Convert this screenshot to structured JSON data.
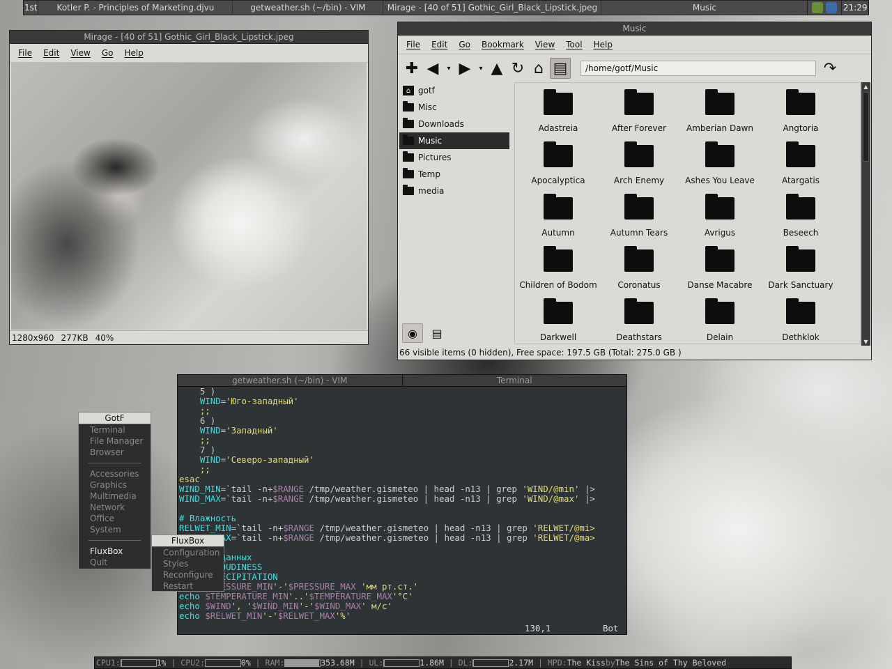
{
  "topbar": {
    "workspace": "1st",
    "tasks": [
      "Kotler P. - Principles of Marketing.djvu",
      "getweather.sh (~/bin) - VIM",
      "Mirage - [40 of 51] Gothic_Girl_Black_Lipstick.jpeg",
      "Music"
    ],
    "clock": "21:29"
  },
  "mirage": {
    "title": "Mirage - [40 of 51] Gothic_Girl_Black_Lipstick.jpeg",
    "menu": [
      "File",
      "Edit",
      "View",
      "Go",
      "Help"
    ],
    "status": [
      "1280x960",
      "277KB",
      "40%"
    ]
  },
  "fm": {
    "title": "Music",
    "menu": [
      "File",
      "Edit",
      "Go",
      "Bookmark",
      "View",
      "Tool",
      "Help"
    ],
    "path": "/home/gotf/Music",
    "sidebar": [
      "gotf",
      "Misc",
      "Downloads",
      "Music",
      "Pictures",
      "Temp",
      "media"
    ],
    "folders": [
      "Adastreia",
      "After Forever",
      "Amberian Dawn",
      "Angtoria",
      "Apocalyptica",
      "Arch Enemy",
      "Ashes You Leave",
      "Atargatis",
      "Autumn",
      "Autumn Tears",
      "Avrigus",
      "Beseech",
      "Children of Bodom",
      "Coronatus",
      "Danse Macabre",
      "Dark Sanctuary",
      "Darkwell",
      "Deathstars",
      "Delain",
      "Dethklok"
    ],
    "status": "66 visible items (0 hidden), Free space: 197.5 GB (Total: 275.0 GB )"
  },
  "terminal": {
    "tabs": [
      "getweather.sh (~/bin) - VIM",
      "Terminal"
    ],
    "position": "130,1",
    "scroll": "Bot"
  },
  "rootmenu": {
    "title": "GotF",
    "group1": [
      "Terminal",
      "File Manager",
      "Browser"
    ],
    "group2": [
      "Accessories",
      "Graphics",
      "Multimedia",
      "Network",
      "Office",
      "System"
    ],
    "group3": [
      "FluxBox",
      "Quit"
    ]
  },
  "fluxmenu": {
    "title": "FluxBox",
    "items": [
      "Configuration",
      "Styles",
      "Reconfigure",
      "Restart"
    ]
  },
  "bottombar": {
    "cpu1_label": "CPU1:",
    "cpu1_value": "1%",
    "cpu1_fill": 0.01,
    "cpu2_label": "CPU2:",
    "cpu2_value": "0%",
    "cpu2_fill": 0.0,
    "ram_label": "RAM:",
    "ram_value": "353.68M",
    "ram_fill": 0.97,
    "ul_label": "UL:",
    "ul_value": "1.86M",
    "ul_fill": 0.02,
    "dl_label": "DL:",
    "dl_value": "2.17M",
    "dl_fill": 0.02,
    "mpd_label": "MPD:",
    "mpd_track": "The Kiss",
    "mpd_by": "by",
    "mpd_artist": "The Sins of Thy Beloved"
  }
}
